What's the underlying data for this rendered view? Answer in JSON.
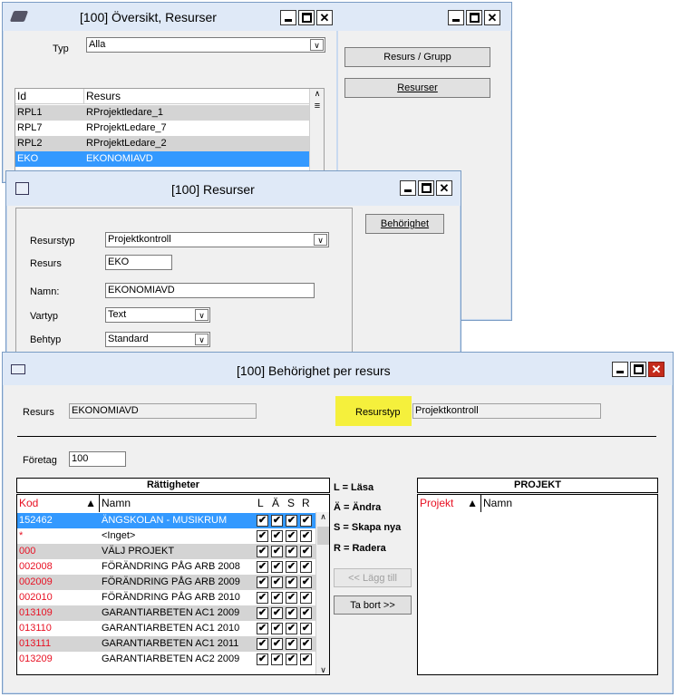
{
  "win1": {
    "title": "[100]  Översikt, Resurser",
    "typ_label": "Typ",
    "typ_value": "Alla",
    "cols": [
      "Id",
      "Resurs"
    ],
    "rows": [
      {
        "id": "RPL1",
        "name": "RProjektledare_1"
      },
      {
        "id": "RPL7",
        "name": "RProjektLedare_7"
      },
      {
        "id": "RPL2",
        "name": "RProjektLedare_2"
      },
      {
        "id": "EKO",
        "name": "EKONOMIAVD"
      }
    ],
    "btn_resurs_grupp": "Resurs / Grupp",
    "btn_resurser": "Resurser"
  },
  "win2": {
    "title": "[100]  Resurser",
    "btn_behorighet": "Behörighet",
    "resurstyp_label": "Resurstyp",
    "resurstyp_value": "Projektkontroll",
    "resurs_label": "Resurs",
    "resurs_value": "EKO",
    "namn_label": "Namn:",
    "namn_value": "EKONOMIAVD",
    "vartyp_label": "Vartyp",
    "vartyp_value": "Text",
    "behtyp_label": "Behtyp",
    "behtyp_value": "Standard"
  },
  "win3": {
    "title": "[100]  Behörighet per resurs",
    "resurs_label": "Resurs",
    "resurs_value": "EKONOMIAVD",
    "resurstyp_label": "Resurstyp",
    "resurstyp_value": "Projektkontroll",
    "foretag_label": "Företag",
    "foretag_value": "100",
    "rattigheter_title": "Rättigheter",
    "col_kod": "Kod",
    "col_namn": "Namn",
    "col_L": "L",
    "col_A": "Ä",
    "col_S": "S",
    "col_R": "R",
    "rows": [
      {
        "kod": "152462",
        "namn": "ÄNGSKOLAN - MUSIKRUM"
      },
      {
        "kod": "*",
        "namn": "<Inget>"
      },
      {
        "kod": "000",
        "namn": "VÄLJ PROJEKT"
      },
      {
        "kod": "002008",
        "namn": "FÖRÄNDRING PÅG ARB 2008"
      },
      {
        "kod": "002009",
        "namn": "FÖRÄNDRING PÅG ARB 2009"
      },
      {
        "kod": "002010",
        "namn": "FÖRÄNDRING PÅG ARB 2010"
      },
      {
        "kod": "013109",
        "namn": "GARANTIARBETEN AC1 2009"
      },
      {
        "kod": "013110",
        "namn": "GARANTIARBETEN AC1 2010"
      },
      {
        "kod": "013111",
        "namn": "GARANTIARBETEN AC1 2011"
      },
      {
        "kod": "013209",
        "namn": "GARANTIARBETEN AC2 2009"
      }
    ],
    "legend": {
      "L": "L = Läsa",
      "A": "Ä = Ändra",
      "S": "S = Skapa nya",
      "R": "R = Radera"
    },
    "btn_lagg_till": "<<  Lägg till",
    "btn_ta_bort": "Ta bort    >>",
    "projekt_title": "PROJEKT",
    "col_projekt": "Projekt",
    "col_projekt_namn": "Namn"
  },
  "colors": {
    "red_text": "#e81123",
    "selection": "#3399ff",
    "highlight_yellow": "#f5f03c"
  }
}
